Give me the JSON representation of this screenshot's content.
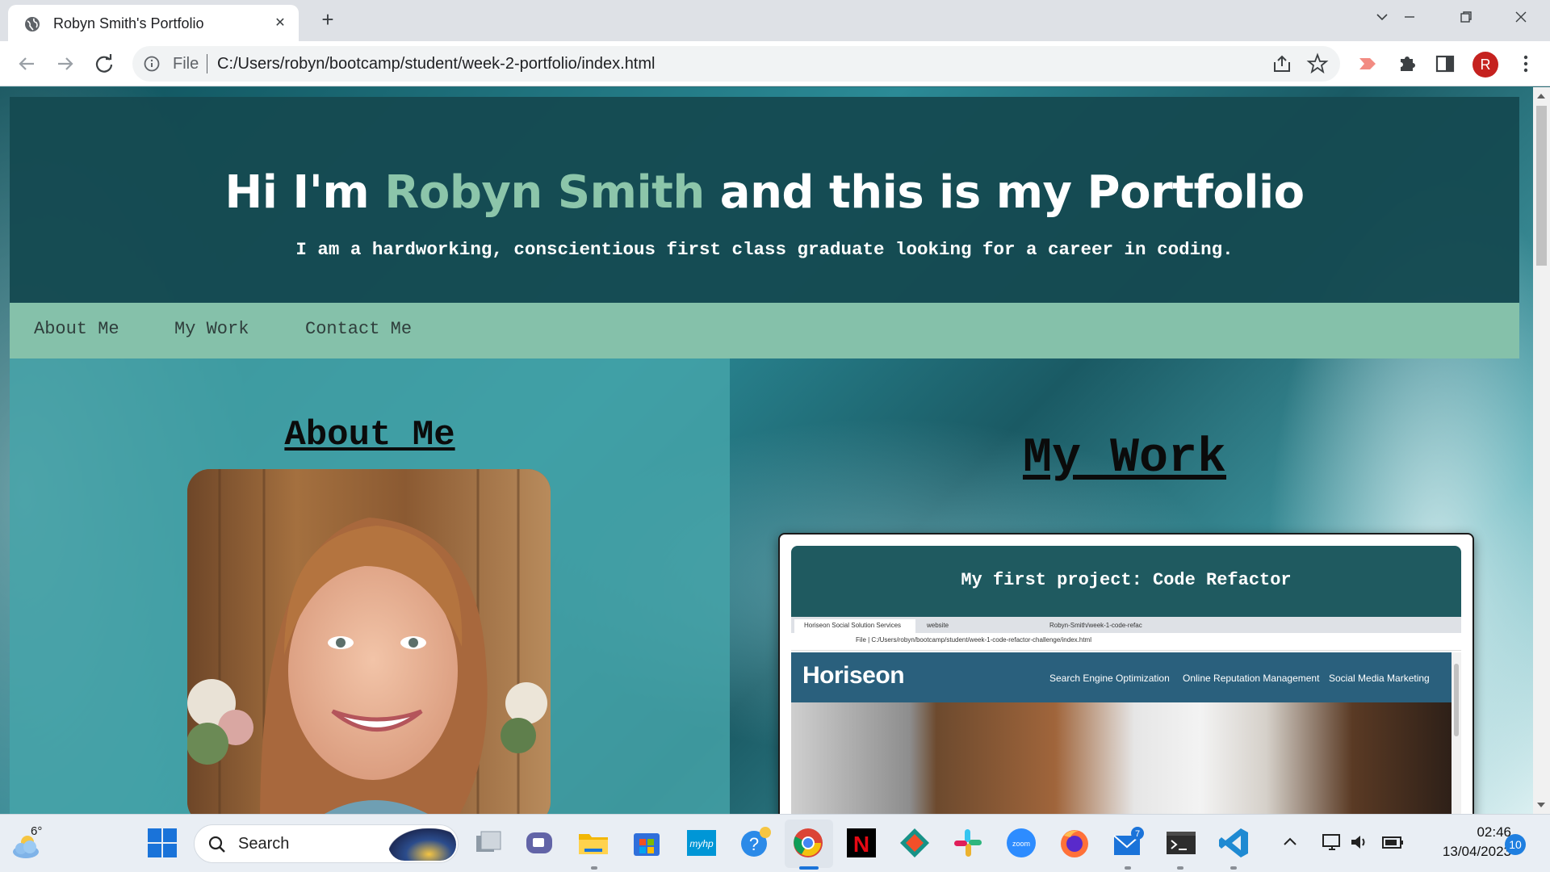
{
  "browser": {
    "tab_title": "Robyn Smith's Portfolio",
    "tab_close": "✕",
    "new_tab": "+",
    "scheme_label": "File",
    "url": "C:/Users/robyn/bootcamp/student/week-2-portfolio/index.html",
    "profile_initial": "R"
  },
  "page": {
    "headline_prefix": "Hi I'm ",
    "headline_name": "Robyn Smith",
    "headline_suffix": " and this is my Portfolio",
    "tagline": "I am a hardworking, conscientious first class graduate looking for a career in coding.",
    "nav": [
      "About Me",
      "My Work",
      "Contact Me"
    ],
    "about_title": "About Me",
    "work_title": "My Work",
    "project": {
      "title": "My first project: Code Refactor",
      "screenshot": {
        "tabs": [
          "Horiseon Social Solution Services",
          "website",
          "Robyn-Smith/week-1-code-refac"
        ],
        "url": "File | C:/Users/robyn/bootcamp/student/week-1-code-refactor-challenge/index.html",
        "brand": "Horiseon",
        "links": [
          "Search Engine Optimization",
          "Online Reputation Management",
          "Social Media Marketing"
        ]
      }
    }
  },
  "taskbar": {
    "temperature": "6°",
    "search_label": "Search",
    "mail_badge": "7",
    "time": "02:46",
    "date": "13/04/2023",
    "notifications": "10"
  },
  "colors": {
    "header_bg": "#154a51",
    "name_accent": "#8cc5aa",
    "nav_bg": "#85c1aa",
    "left_panel": "#46a5aa",
    "card_head": "#1f5a60"
  }
}
